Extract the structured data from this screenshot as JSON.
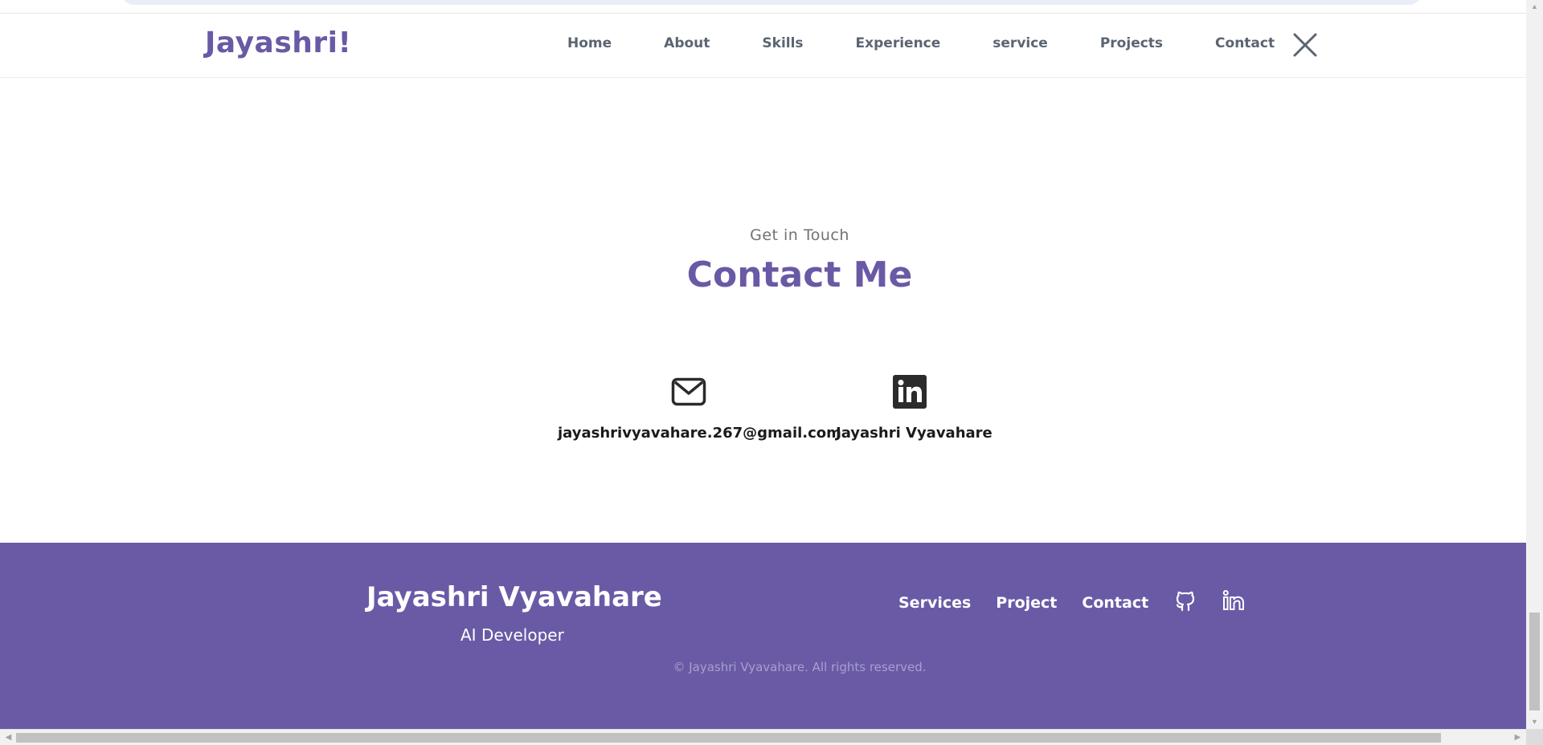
{
  "header": {
    "logo": "Jayashri!",
    "nav": [
      "Home",
      "About",
      "Skills",
      "Experience",
      "service",
      "Projects",
      "Contact"
    ],
    "close_icon": "close-icon"
  },
  "contact": {
    "subtitle": "Get in Touch",
    "title": "Contact Me",
    "items": [
      {
        "icon": "mail-icon",
        "label": "jayashrivyavahare.267@gmail.com"
      },
      {
        "icon": "linkedin-icon",
        "label": "Jayashri Vyavahare"
      }
    ]
  },
  "footer": {
    "name": "Jayashri Vyavahare",
    "role": "AI Developer",
    "links": [
      "Services",
      "Project",
      "Contact"
    ],
    "social_icons": [
      "github-icon",
      "linkedin-icon"
    ],
    "copyright": "© Jayashri Vyavahare. All rights reserved."
  },
  "colors": {
    "brand": "#6a59a5",
    "footer_bg": "#6a5aa6",
    "nav_text": "#5b6472"
  }
}
